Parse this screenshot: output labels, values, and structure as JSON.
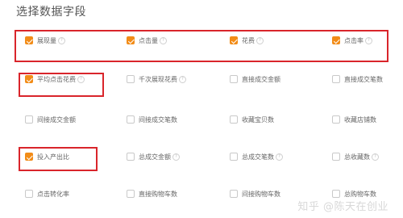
{
  "title": "选择数据字段",
  "help_glyph": "?",
  "fields": [
    {
      "id": "impressions",
      "label": "展现量",
      "checked": true,
      "help": true
    },
    {
      "id": "clicks",
      "label": "点击量",
      "checked": true,
      "help": true
    },
    {
      "id": "cost",
      "label": "花费",
      "checked": true,
      "help": true
    },
    {
      "id": "ctr",
      "label": "点击率",
      "checked": true,
      "help": true
    },
    {
      "id": "avg-cpc",
      "label": "平均点击花费",
      "checked": true,
      "help": true
    },
    {
      "id": "cpm",
      "label": "千次展现花费",
      "checked": false,
      "help": true
    },
    {
      "id": "direct-gmv",
      "label": "直接成交金额",
      "checked": false,
      "help": false
    },
    {
      "id": "direct-orders",
      "label": "直接成交笔数",
      "checked": false,
      "help": false
    },
    {
      "id": "indirect-gmv",
      "label": "间接成交金额",
      "checked": false,
      "help": false
    },
    {
      "id": "indirect-orders",
      "label": "间接成交笔数",
      "checked": false,
      "help": false
    },
    {
      "id": "item-favorites",
      "label": "收藏宝贝数",
      "checked": false,
      "help": false
    },
    {
      "id": "shop-favorites",
      "label": "收藏店铺数",
      "checked": false,
      "help": false
    },
    {
      "id": "roi",
      "label": "投入产出比",
      "checked": true,
      "help": false
    },
    {
      "id": "total-gmv",
      "label": "总成交金额",
      "checked": false,
      "help": true
    },
    {
      "id": "total-orders",
      "label": "总成交笔数",
      "checked": false,
      "help": true
    },
    {
      "id": "total-favorites",
      "label": "总收藏数",
      "checked": false,
      "help": true
    },
    {
      "id": "click-cvr",
      "label": "点击转化率",
      "checked": false,
      "help": false
    },
    {
      "id": "direct-cart",
      "label": "直接购物车数",
      "checked": false,
      "help": false
    },
    {
      "id": "indirect-cart",
      "label": "间接购物车数",
      "checked": false,
      "help": false
    },
    {
      "id": "total-cart",
      "label": "总购物车数",
      "checked": false,
      "help": false
    }
  ],
  "watermark": "知乎 @陈天在创业",
  "colors": {
    "accent": "#f28c18",
    "highlight": "#d9252b"
  }
}
